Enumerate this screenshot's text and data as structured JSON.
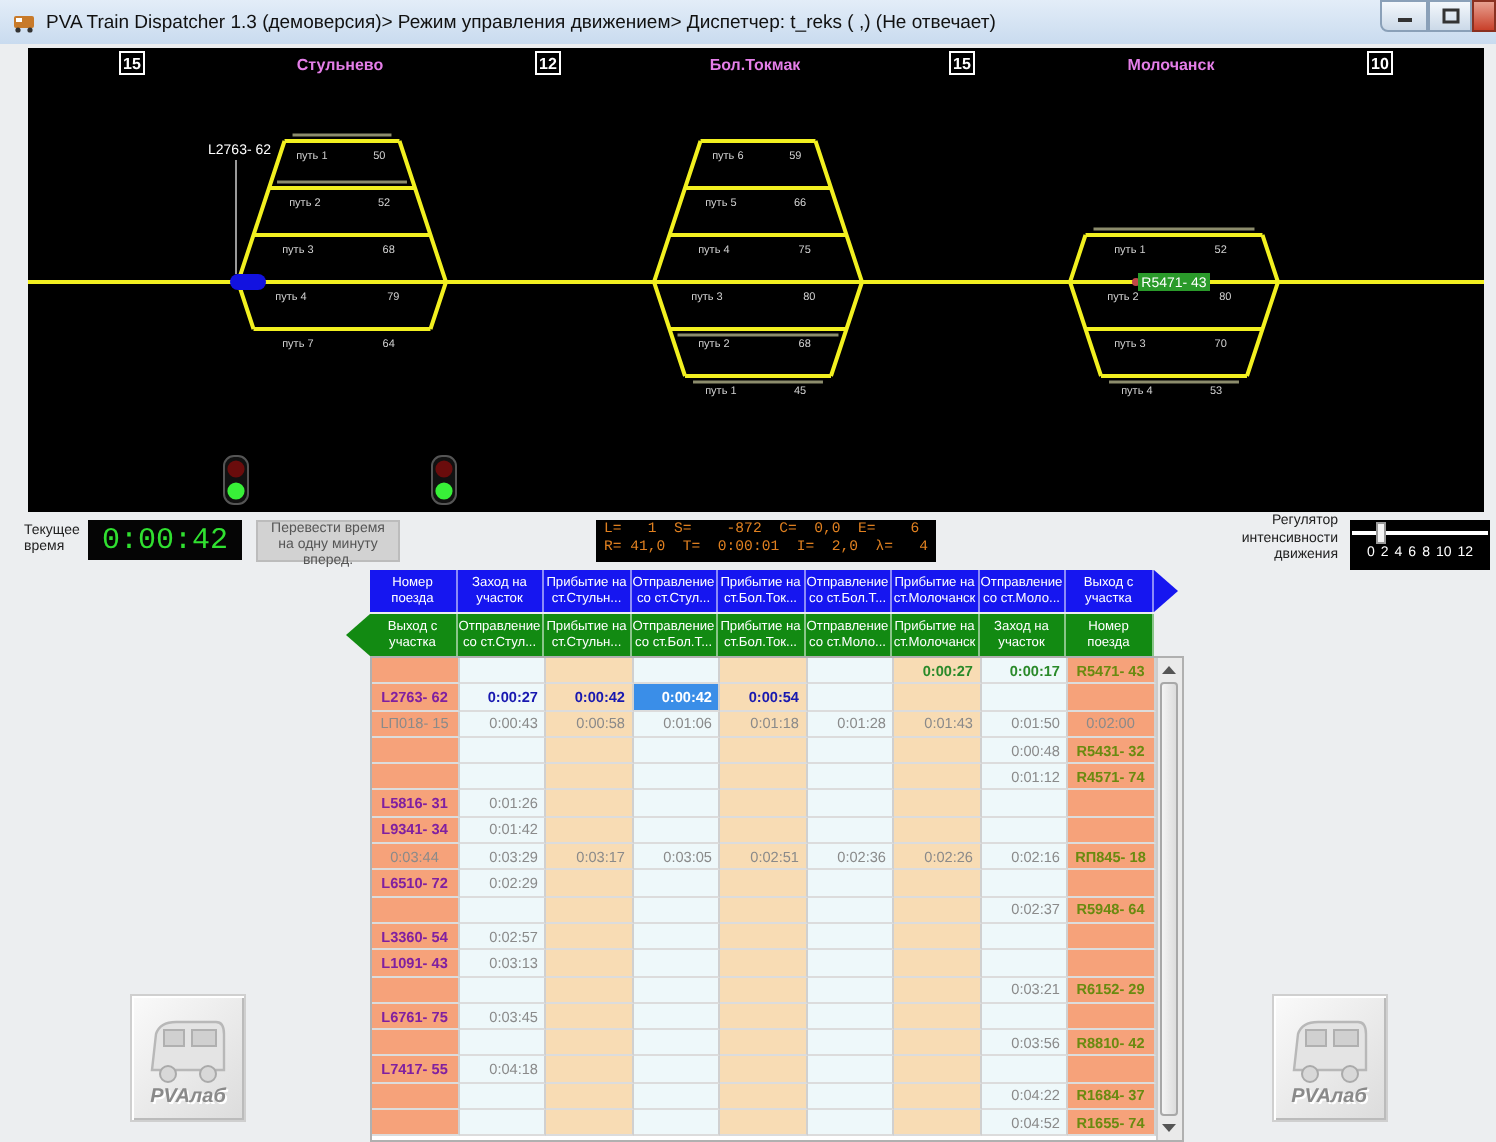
{
  "window": {
    "title": "PVA Train Dispatcher 1.3 (демоверсия)> Режим управления движением> Диспетчер: t_reks ( ,) (Не отвечает)"
  },
  "track_diagram": {
    "distances": [
      "15",
      "12",
      "15",
      "10"
    ],
    "stations": [
      {
        "name": "Стульнево",
        "tracks": [
          {
            "label": "путь 1",
            "length": "50",
            "kind": "upper",
            "occupied": true
          },
          {
            "label": "путь 2",
            "length": "52",
            "kind": "upper",
            "occupied": true
          },
          {
            "label": "путь 3",
            "length": "68",
            "kind": "upper",
            "occupied": false
          },
          {
            "label": "путь 4",
            "length": "79",
            "kind": "main",
            "occupied": false
          },
          {
            "label": "путь 7",
            "length": "64",
            "kind": "lower",
            "occupied": false
          }
        ]
      },
      {
        "name": "Бол.Токмак",
        "tracks": [
          {
            "label": "путь 6",
            "length": "59",
            "kind": "upper",
            "occupied": false
          },
          {
            "label": "путь 5",
            "length": "66",
            "kind": "upper",
            "occupied": false
          },
          {
            "label": "путь 4",
            "length": "75",
            "kind": "upper",
            "occupied": false
          },
          {
            "label": "путь 3",
            "length": "80",
            "kind": "main",
            "occupied": false
          },
          {
            "label": "путь 2",
            "length": "68",
            "kind": "lower",
            "occupied": true
          },
          {
            "label": "путь 1",
            "length": "45",
            "kind": "lower",
            "occupied": true
          }
        ]
      },
      {
        "name": "Молочанск",
        "tracks": [
          {
            "label": "путь 1",
            "length": "52",
            "kind": "upper",
            "occupied": true
          },
          {
            "label": "путь 2",
            "length": "80",
            "kind": "main",
            "occupied": false
          },
          {
            "label": "путь 3",
            "length": "70",
            "kind": "lower",
            "occupied": false
          },
          {
            "label": "путь 4",
            "length": "53",
            "kind": "lower",
            "occupied": true
          }
        ]
      }
    ],
    "trains": [
      {
        "label": "L2763- 62",
        "kind": "left"
      },
      {
        "label": "R5471- 43",
        "kind": "right"
      }
    ],
    "signals": [
      {
        "green_on": true,
        "red_on": false
      },
      {
        "green_on": true,
        "red_on": false
      }
    ]
  },
  "clock": {
    "label": "Текущее время",
    "value": "0:00:42"
  },
  "advance_button": "Перевести время на одну минуту вперед.",
  "stats": [
    "L=   1  S=    -872  C=  0,0  E=    6",
    "R= 41,0  T=  0:00:01  I=  2,0  λ=   4"
  ],
  "intensity": {
    "label": "Регулятор интенсивности движения",
    "level": 0.167,
    "ticks": [
      "0",
      "2",
      "4",
      "6",
      "8",
      "10",
      "12"
    ]
  },
  "schedule": {
    "header_forward": [
      "Номер поезда",
      "Заход на участок",
      "Прибытие на ст.Стульн...",
      "Отправление со ст.Стул...",
      "Прибытие на ст.Бол.Ток...",
      "Отправление со ст.Бол.Т...",
      "Прибытие на ст.Молочанск",
      "Отправление со ст.Моло...",
      "Выход с участка"
    ],
    "header_backward": [
      "Выход с участка",
      "Отправление со ст.Стул...",
      "Прибытие на ст.Стульн...",
      "Отправление со ст.Бол.Т...",
      "Прибытие на ст.Бол.Ток...",
      "Отправление со ст.Моло...",
      "Прибытие на ст.Молочанск",
      "Заход на участок",
      "Номер поезда"
    ],
    "rows": [
      {
        "kind": "right-active",
        "cells": [
          "",
          "",
          "",
          "",
          "",
          "",
          "0:00:27",
          "0:00:17",
          "R5471- 43"
        ]
      },
      {
        "kind": "left-active",
        "cells": [
          "L2763- 62",
          "0:00:27",
          "0:00:42",
          {
            "text": "0:00:42",
            "selected": true
          },
          "0:00:54",
          "",
          "",
          "",
          ""
        ]
      },
      {
        "kind": "left-planned",
        "cells": [
          "LП018- 15",
          "0:00:43",
          "0:00:58",
          "0:01:06",
          "0:01:18",
          "0:01:28",
          "0:01:43",
          "0:01:50",
          "0:02:00"
        ]
      },
      {
        "kind": "right",
        "cells": [
          "",
          "",
          "",
          "",
          "",
          "",
          "",
          "0:00:48",
          "R5431- 32"
        ]
      },
      {
        "kind": "right",
        "cells": [
          "",
          "",
          "",
          "",
          "",
          "",
          "",
          "0:01:12",
          "R4571- 74"
        ]
      },
      {
        "kind": "left",
        "cells": [
          "L5816- 31",
          "0:01:26",
          "",
          "",
          "",
          "",
          "",
          "",
          ""
        ]
      },
      {
        "kind": "left",
        "cells": [
          "L9341- 34",
          "0:01:42",
          "",
          "",
          "",
          "",
          "",
          "",
          ""
        ]
      },
      {
        "kind": "right",
        "cells": [
          "0:03:44",
          "0:03:29",
          "0:03:17",
          "0:03:05",
          "0:02:51",
          "0:02:36",
          "0:02:26",
          "0:02:16",
          "RП845- 18"
        ]
      },
      {
        "kind": "left",
        "cells": [
          "L6510- 72",
          "0:02:29",
          "",
          "",
          "",
          "",
          "",
          "",
          ""
        ]
      },
      {
        "kind": "right",
        "cells": [
          "",
          "",
          "",
          "",
          "",
          "",
          "",
          "0:02:37",
          "R5948- 64"
        ]
      },
      {
        "kind": "left",
        "cells": [
          "L3360- 54",
          "0:02:57",
          "",
          "",
          "",
          "",
          "",
          "",
          ""
        ]
      },
      {
        "kind": "left",
        "cells": [
          "L1091- 43",
          "0:03:13",
          "",
          "",
          "",
          "",
          "",
          "",
          ""
        ]
      },
      {
        "kind": "right",
        "cells": [
          "",
          "",
          "",
          "",
          "",
          "",
          "",
          "0:03:21",
          "R6152- 29"
        ]
      },
      {
        "kind": "left",
        "cells": [
          "L6761- 75",
          "0:03:45",
          "",
          "",
          "",
          "",
          "",
          "",
          ""
        ]
      },
      {
        "kind": "right",
        "cells": [
          "",
          "",
          "",
          "",
          "",
          "",
          "",
          "0:03:56",
          "R8810- 42"
        ]
      },
      {
        "kind": "left",
        "cells": [
          "L7417- 55",
          "0:04:18",
          "",
          "",
          "",
          "",
          "",
          "",
          ""
        ]
      },
      {
        "kind": "right",
        "cells": [
          "",
          "",
          "",
          "",
          "",
          "",
          "",
          "0:04:22",
          "R1684- 37"
        ]
      },
      {
        "kind": "right",
        "cells": [
          "",
          "",
          "",
          "",
          "",
          "",
          "",
          "0:04:52",
          "R1655- 74"
        ]
      }
    ]
  },
  "logos": [
    "PVAлаб",
    "PVAлаб"
  ]
}
